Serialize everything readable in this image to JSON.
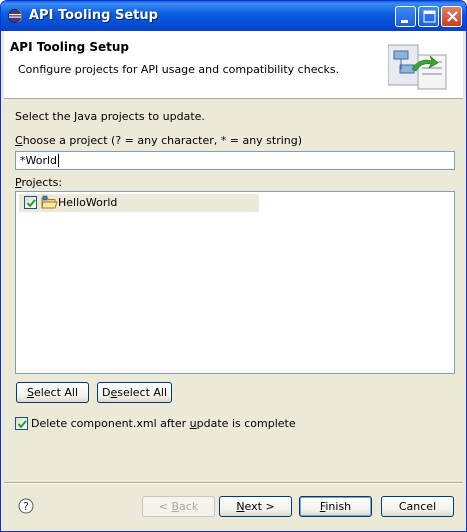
{
  "window": {
    "title": "API Tooling Setup",
    "icon": "eclipse-icon",
    "controls": [
      "minimize-icon",
      "maximize-icon",
      "close-icon"
    ]
  },
  "header": {
    "title": "API Tooling Setup",
    "description": "Configure projects for API usage and compatibility checks.",
    "art_icon": "api-tooling-wizard-banner"
  },
  "content": {
    "instruction": "Select the Java projects to update.",
    "choose_label": {
      "mnemonic": "C",
      "rest": "hoose a project (? = any character, * = any string)"
    },
    "filter_value": "*World",
    "projects_label": {
      "mnemonic": "P",
      "rest": "rojects:"
    },
    "projects": [
      {
        "name": "HelloWorld",
        "checked": true,
        "icon": "java-project-icon"
      }
    ],
    "select_all": {
      "mnemonic": "S",
      "rest": "elect All"
    },
    "deselect_all": {
      "pre": "D",
      "mnemonic": "e",
      "rest": "select All"
    },
    "delete_option": {
      "checked": true,
      "pre": "Delete component.xml after ",
      "mnemonic": "u",
      "rest": "pdate is complete"
    }
  },
  "footer": {
    "help_icon": "help-icon",
    "back": {
      "pre": "< ",
      "mnemonic": "B",
      "rest": "ack",
      "enabled": false
    },
    "next": {
      "mnemonic": "N",
      "rest": "ext >"
    },
    "finish": {
      "mnemonic": "F",
      "rest": "inish"
    },
    "cancel": "Cancel"
  },
  "colors": {
    "titlebar": "#0b61e3",
    "dialog_bg": "#ece9d8",
    "input_border": "#7f9db9",
    "check_mark": "#21a121"
  }
}
